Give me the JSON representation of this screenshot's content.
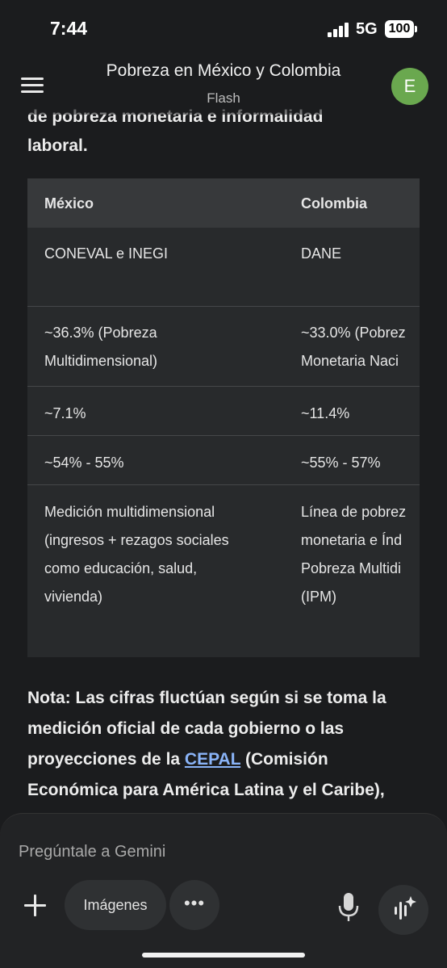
{
  "status_bar": {
    "time": "7:44",
    "network": "5G",
    "battery": "100"
  },
  "header": {
    "title": "Pobreza en México y Colombia",
    "subtitle": "Flash",
    "avatar_letter": "E"
  },
  "content": {
    "intro_lines": [
      "de pobreza monetaria e informalidad",
      "laboral."
    ],
    "table": {
      "headers": [
        "México",
        "Colombia"
      ],
      "rows": [
        {
          "mx": [
            "CONEVAL e INEGI"
          ],
          "co": [
            "DANE"
          ]
        },
        {
          "mx": [
            "~36.3% (Pobreza",
            "Multidimensional)"
          ],
          "co": [
            "~33.0% (Pobrez",
            "Monetaria Naci"
          ]
        },
        {
          "mx": [
            "~7.1%"
          ],
          "co": [
            "~11.4%"
          ]
        },
        {
          "mx": [
            "~54% - 55%"
          ],
          "co": [
            "~55% - 57%"
          ]
        },
        {
          "mx": [
            "Medición multidimensional",
            "(ingresos + rezagos sociales",
            "como educación, salud,",
            "vivienda)"
          ],
          "co": [
            "Línea de pobrez",
            "monetaria e Índ",
            "Pobreza Multidi",
            "(IPM)"
          ]
        }
      ]
    },
    "note": {
      "line1": "Nota: Las cifras fluctúan según si se toma la",
      "line2": "medición oficial de cada gobierno o las",
      "line3_pre": "proyecciones de la ",
      "line3_link": "CEPAL",
      "line3_post": " (Comisión",
      "line4": "Económica para América Latina y el Caribe),"
    }
  },
  "composer": {
    "placeholder": "Pregúntale a Gemini",
    "images_label": "Imágenes",
    "more_label": "•••"
  },
  "colors": {
    "accent_link": "#8ab4f8",
    "avatar": "#6aa84f",
    "background": "#1b1c1e"
  }
}
